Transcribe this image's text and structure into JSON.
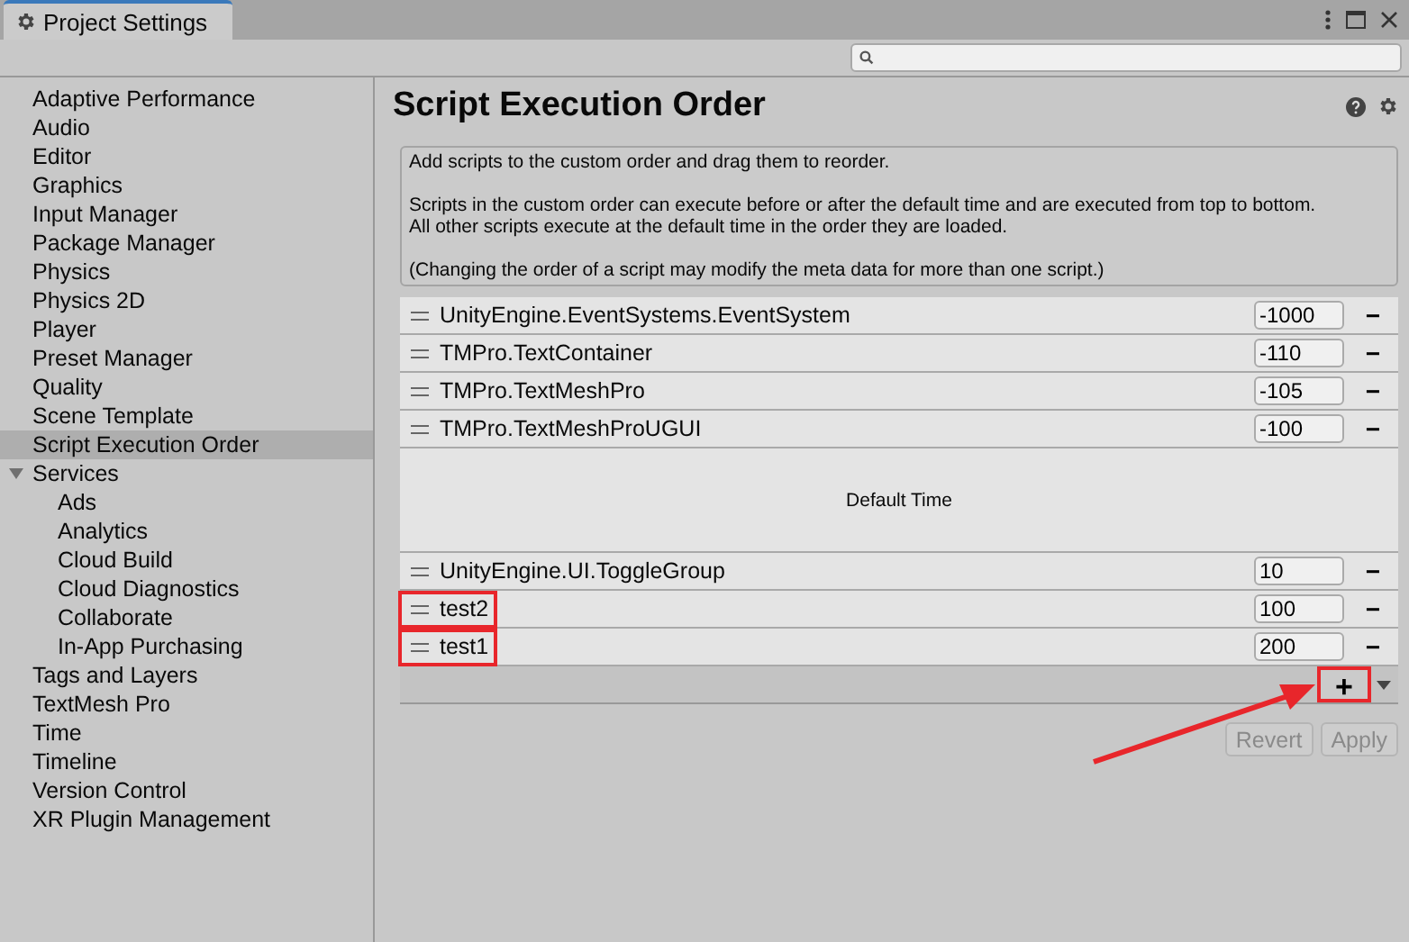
{
  "window": {
    "title": "Project Settings"
  },
  "sidebar": {
    "items": [
      {
        "label": "Adaptive Performance",
        "selected": false
      },
      {
        "label": "Audio",
        "selected": false
      },
      {
        "label": "Editor",
        "selected": false
      },
      {
        "label": "Graphics",
        "selected": false
      },
      {
        "label": "Input Manager",
        "selected": false
      },
      {
        "label": "Package Manager",
        "selected": false
      },
      {
        "label": "Physics",
        "selected": false
      },
      {
        "label": "Physics 2D",
        "selected": false
      },
      {
        "label": "Player",
        "selected": false
      },
      {
        "label": "Preset Manager",
        "selected": false
      },
      {
        "label": "Quality",
        "selected": false
      },
      {
        "label": "Scene Template",
        "selected": false
      },
      {
        "label": "Script Execution Order",
        "selected": true
      },
      {
        "label": "Services",
        "selected": false,
        "expanded": true,
        "children": [
          {
            "label": "Ads",
            "selected": false
          },
          {
            "label": "Analytics",
            "selected": false
          },
          {
            "label": "Cloud Build",
            "selected": false
          },
          {
            "label": "Cloud Diagnostics",
            "selected": false
          },
          {
            "label": "Collaborate",
            "selected": false
          },
          {
            "label": "In-App Purchasing",
            "selected": false
          }
        ]
      },
      {
        "label": "Tags and Layers",
        "selected": false
      },
      {
        "label": "TextMesh Pro",
        "selected": false
      },
      {
        "label": "Time",
        "selected": false
      },
      {
        "label": "Timeline",
        "selected": false
      },
      {
        "label": "Version Control",
        "selected": false
      },
      {
        "label": "XR Plugin Management",
        "selected": false
      }
    ]
  },
  "main": {
    "title": "Script Execution Order",
    "description": [
      "Add scripts to the custom order and drag them to reorder.",
      "Scripts in the custom order can execute before or after the default time and are executed from top to bottom.\nAll other scripts execute at the default time in the order they are loaded.",
      "(Changing the order of a script may modify the meta data for more than one script.)"
    ],
    "list": [
      {
        "kind": "script",
        "name": "UnityEngine.EventSystems.EventSystem",
        "order": "-1000",
        "remove": "−",
        "highlighted": false
      },
      {
        "kind": "script",
        "name": "TMPro.TextContainer",
        "order": "-110",
        "remove": "−",
        "highlighted": false
      },
      {
        "kind": "script",
        "name": "TMPro.TextMeshPro",
        "order": "-105",
        "remove": "−",
        "highlighted": false
      },
      {
        "kind": "script",
        "name": "TMPro.TextMeshProUGUI",
        "order": "-100",
        "remove": "−",
        "highlighted": false
      },
      {
        "kind": "default",
        "name": "Default Time"
      },
      {
        "kind": "script",
        "name": "UnityEngine.UI.ToggleGroup",
        "order": "10",
        "remove": "−",
        "highlighted": false
      },
      {
        "kind": "script",
        "name": "test2",
        "order": "100",
        "remove": "−",
        "highlighted": true
      },
      {
        "kind": "script",
        "name": "test1",
        "order": "200",
        "remove": "−",
        "highlighted": true
      }
    ],
    "add_button": {
      "label": "+",
      "highlighted": true
    },
    "buttons": [
      {
        "label": "Revert",
        "disabled": true
      },
      {
        "label": "Apply",
        "disabled": true
      }
    ]
  }
}
